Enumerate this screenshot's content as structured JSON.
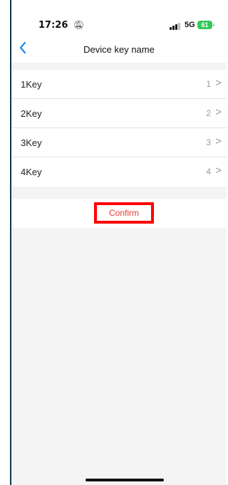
{
  "status_bar": {
    "time": "17:26",
    "network": "5G",
    "battery": "61"
  },
  "nav": {
    "back_icon": "chevron-left-icon",
    "title": "Device key name"
  },
  "keys": [
    {
      "label": "1Key",
      "value": "1"
    },
    {
      "label": "2Key",
      "value": "2"
    },
    {
      "label": "3Key",
      "value": "3"
    },
    {
      "label": "4Key",
      "value": "4"
    }
  ],
  "confirm": {
    "label": "Confirm"
  },
  "colors": {
    "accent": "#1e88e5",
    "confirm_text": "#e53935",
    "highlight_border": "#ff0000",
    "battery": "#35c759"
  }
}
